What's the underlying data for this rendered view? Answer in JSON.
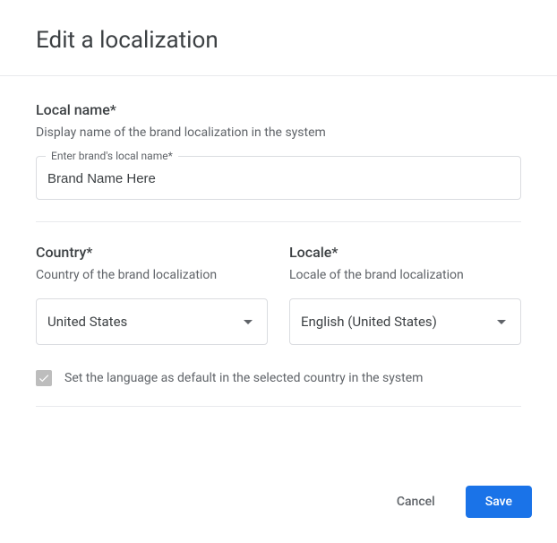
{
  "dialog": {
    "title": "Edit a localization"
  },
  "localName": {
    "label": "Local name*",
    "description": "Display name of the brand localization in the system",
    "floatLabel": "Enter brand's local name*",
    "value": "Brand Name Here"
  },
  "country": {
    "label": "Country*",
    "description": "Country of the brand localization",
    "value": "United States"
  },
  "locale": {
    "label": "Locale*",
    "description": "Locale of the brand localization",
    "value": "English (United States)"
  },
  "defaultLang": {
    "label": "Set the language as default in the selected country in the system",
    "checked": true
  },
  "footer": {
    "cancel": "Cancel",
    "save": "Save"
  }
}
